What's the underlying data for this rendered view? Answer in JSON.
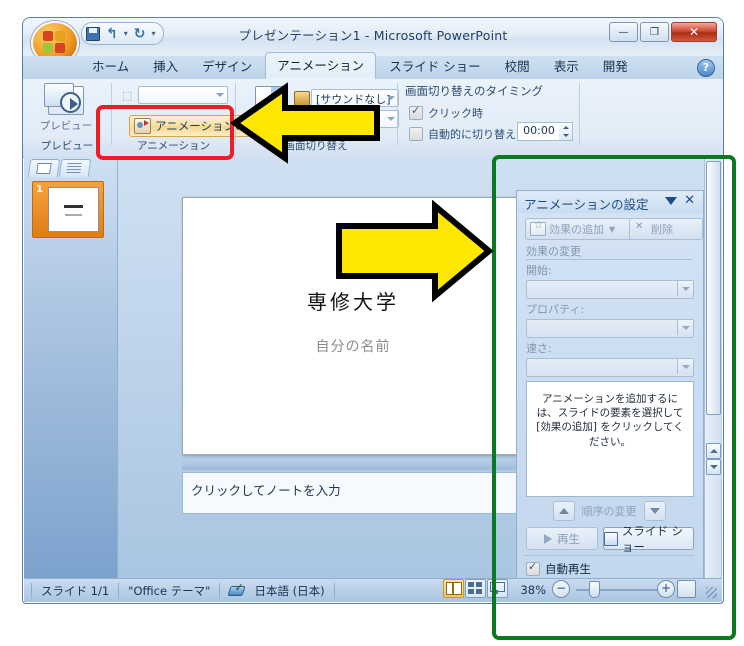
{
  "window": {
    "title": "プレゼンテーション1 - Microsoft PowerPoint",
    "quick_access": {
      "save_icon": "save-icon",
      "undo_icon": "undo-icon",
      "redo_icon": "redo-icon",
      "more_icon": "chevron-down-icon"
    },
    "controls": {
      "minimize": "—",
      "maximize": "❐",
      "close": "✕"
    },
    "help_label": "?"
  },
  "ribbon": {
    "tabs": [
      {
        "label": "ホーム",
        "active": false
      },
      {
        "label": "挿入",
        "active": false
      },
      {
        "label": "デザイン",
        "active": false
      },
      {
        "label": "アニメーション",
        "active": true
      },
      {
        "label": "スライド ショー",
        "active": false
      },
      {
        "label": "校閲",
        "active": false
      },
      {
        "label": "表示",
        "active": false
      },
      {
        "label": "開発",
        "active": false
      }
    ],
    "groups": [
      {
        "label": "プレビュー"
      },
      {
        "label": "アニメーション"
      },
      {
        "label": "画面切り替え"
      }
    ],
    "preview_button": "プレビュー",
    "animate_combo_value": "",
    "animation_settings_button": "アニメーションの設定",
    "transition_sound_value": "[サウンドなし]",
    "transition_speed_value": "",
    "transition_timing_label": "画面切り替えのタイミング",
    "on_click_label": "クリック時",
    "on_click_checked": true,
    "auto_advance_label": "自動的に切り替え:",
    "auto_advance_checked": false,
    "auto_advance_time": "00:00"
  },
  "slides_pane": {
    "tab_slides_icon": "slide-thumbnail-icon",
    "tab_outline_icon": "outline-icon",
    "thumbnail_number": "1"
  },
  "slide": {
    "title": "専修大学",
    "subtitle": "自分の名前"
  },
  "notes": {
    "placeholder": "クリックしてノートを入力"
  },
  "task_pane": {
    "title": "アニメーションの設定",
    "dropdown_icon": "chevron-down-icon",
    "close_icon": "close-icon",
    "add_effect_button": "効果の追加",
    "add_effect_arrow_icon": "chevron-down-icon",
    "remove_button": "削除",
    "modify_effect_label": "効果の変更",
    "start_label": "開始:",
    "start_value": "",
    "property_label": "プロパティ:",
    "property_value": "",
    "speed_label": "速さ:",
    "speed_value": "",
    "empty_message": "アニメーションを追加するには、スライドの要素を選択して [効果の追加] をクリックしてください。",
    "reorder_label": "順序の変更",
    "reorder_up_icon": "arrow-up-icon",
    "reorder_down_icon": "arrow-down-icon",
    "play_button": "再生",
    "slideshow_button": "スライド ショー",
    "autoplay_label": "自動再生",
    "autoplay_checked": true
  },
  "status_bar": {
    "slide_count": "スライド 1/1",
    "theme": "\"Office テーマ\"",
    "spell_icon": "spellcheck-icon",
    "language": "日本語 (日本)",
    "view_normal_icon": "normal-view-icon",
    "view_sorter_icon": "slide-sorter-icon",
    "view_show_icon": "slideshow-view-icon",
    "zoom": "38%",
    "zoom_out_icon": "minus-icon",
    "zoom_in_icon": "plus-icon",
    "fit_icon": "fit-to-window-icon"
  },
  "annotations": {
    "red_highlight": "アニメーションの設定",
    "green_highlight": "アニメーションの設定 作業ウィンドウ",
    "arrow_left_color": "#ffe800",
    "arrow_right_color": "#ffe800",
    "red_color": "#ee1c25",
    "green_color": "#0a7a20"
  }
}
